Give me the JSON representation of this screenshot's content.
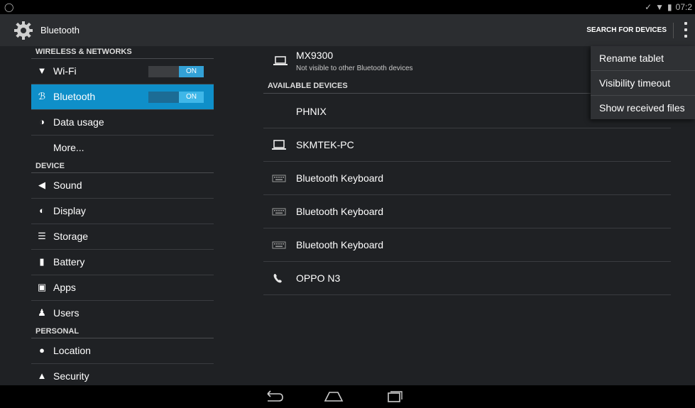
{
  "status": {
    "time": "07:2"
  },
  "actionbar": {
    "title": "Bluetooth",
    "search_label": "SEARCH FOR DEVICES"
  },
  "sidebar": {
    "wireless_header": "WIRELESS & NETWORKS",
    "wifi": {
      "label": "Wi-Fi",
      "toggle": "ON"
    },
    "bluetooth": {
      "label": "Bluetooth",
      "toggle": "ON"
    },
    "data_usage": "Data usage",
    "more": "More...",
    "device_header": "DEVICE",
    "sound": "Sound",
    "display": "Display",
    "storage": "Storage",
    "battery": "Battery",
    "apps": "Apps",
    "users": "Users",
    "personal_header": "PERSONAL",
    "location": "Location",
    "security": "Security"
  },
  "main": {
    "paired": {
      "name": "MX9300",
      "subtitle": "Not visible to other Bluetooth devices"
    },
    "available_header": "AVAILABLE DEVICES",
    "devices": [
      {
        "name": "PHNIX",
        "icon": "none"
      },
      {
        "name": "SKMTEK-PC",
        "icon": "laptop-icon"
      },
      {
        "name": "Bluetooth  Keyboard",
        "icon": "keyboard-icon"
      },
      {
        "name": "Bluetooth  Keyboard",
        "icon": "keyboard-icon"
      },
      {
        "name": "Bluetooth  Keyboard",
        "icon": "keyboard-icon"
      },
      {
        "name": "OPPO N3",
        "icon": "phone-icon"
      }
    ]
  },
  "menu": {
    "rename": "Rename tablet",
    "visibility": "Visibility timeout",
    "received": "Show received files"
  },
  "colors": {
    "accent": "#0f8fc9",
    "toggle_on": "#33a1d6",
    "background": "#1f2124"
  }
}
